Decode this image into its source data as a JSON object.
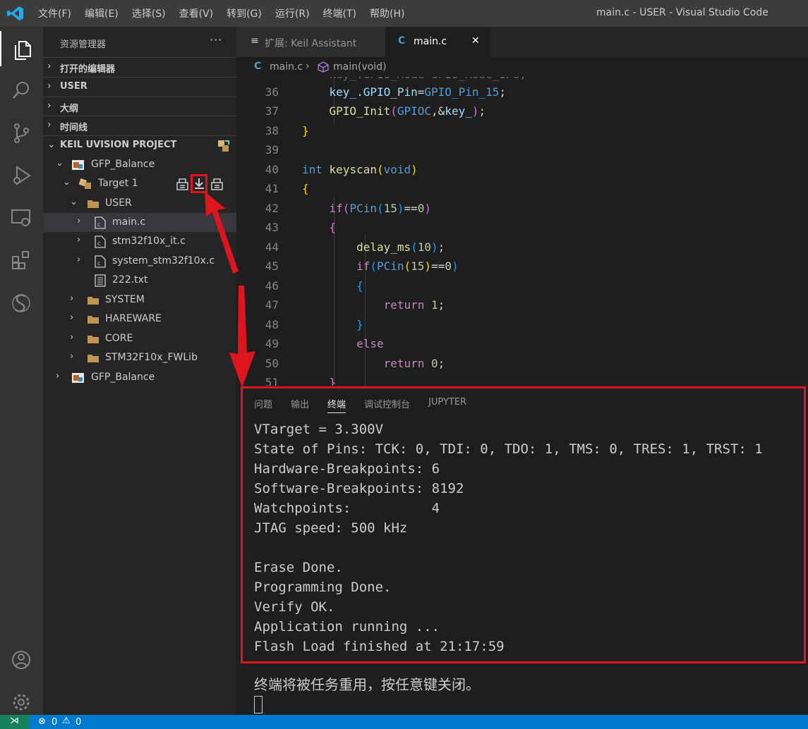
{
  "menu": [
    "文件(F)",
    "编辑(E)",
    "选择(S)",
    "查看(V)",
    "转到(G)",
    "运行(R)",
    "终端(T)",
    "帮助(H)"
  ],
  "window_title": "main.c - USER - Visual Studio Code",
  "sidebar": {
    "title": "资源管理器",
    "more": "···",
    "sections": [
      "打开的编辑器",
      "USER",
      "大纲",
      "时间线",
      "KEIL UVISION PROJECT"
    ],
    "tree": [
      {
        "label": "GFP_Balance",
        "chevron": "⌄"
      },
      {
        "label": "Target 1",
        "chevron": "⌄"
      },
      {
        "label": "USER",
        "chevron": "⌄"
      },
      {
        "label": "main.c",
        "chevron": "›"
      },
      {
        "label": "stm32f10x_it.c",
        "chevron": "›"
      },
      {
        "label": "system_stm32f10x.c",
        "chevron": "›"
      },
      {
        "label": "222.txt",
        "chevron": ""
      },
      {
        "label": "SYSTEM",
        "chevron": "›"
      },
      {
        "label": "HAREWARE",
        "chevron": "›"
      },
      {
        "label": "CORE",
        "chevron": "›"
      },
      {
        "label": "STM32F10x_FWLib",
        "chevron": "›"
      },
      {
        "label": "GFP_Balance",
        "chevron": "›"
      }
    ]
  },
  "tabs": {
    "tab1": "扩展: Keil Assistant",
    "tab2": "main.c",
    "close": "✕",
    "c_letter": "C"
  },
  "breadcrumb": {
    "file": "main.c",
    "sep": "›",
    "symbol": "main(void)"
  },
  "code": {
    "line_numbers": [
      "36",
      "37",
      "38",
      "39",
      "40",
      "41",
      "42",
      "43",
      "44",
      "45",
      "46",
      "47",
      "48",
      "49",
      "50",
      "51"
    ]
  },
  "panel": {
    "tabs": [
      "问题",
      "输出",
      "终端",
      "调试控制台",
      "JUPYTER"
    ],
    "active_tab": "终端",
    "terminal_lines": [
      "VTarget = 3.300V",
      "State of Pins: TCK: 0, TDI: 0, TDO: 1, TMS: 0, TRES: 1, TRST: 1",
      "Hardware-Breakpoints: 6",
      "Software-Breakpoints: 8192",
      "Watchpoints:          4",
      "JTAG speed: 500 kHz",
      "",
      "Erase Done.",
      "Programming Done.",
      "Verify OK.",
      "Application running ...",
      "Flash Load finished at 21:17:59"
    ],
    "reuse_message": "终端将被任务重用，按任意键关闭。"
  },
  "status": {
    "errors": "0",
    "warnings": "0"
  },
  "colors": {
    "accent": "#007acc",
    "highlight_red": "#e0141e"
  }
}
